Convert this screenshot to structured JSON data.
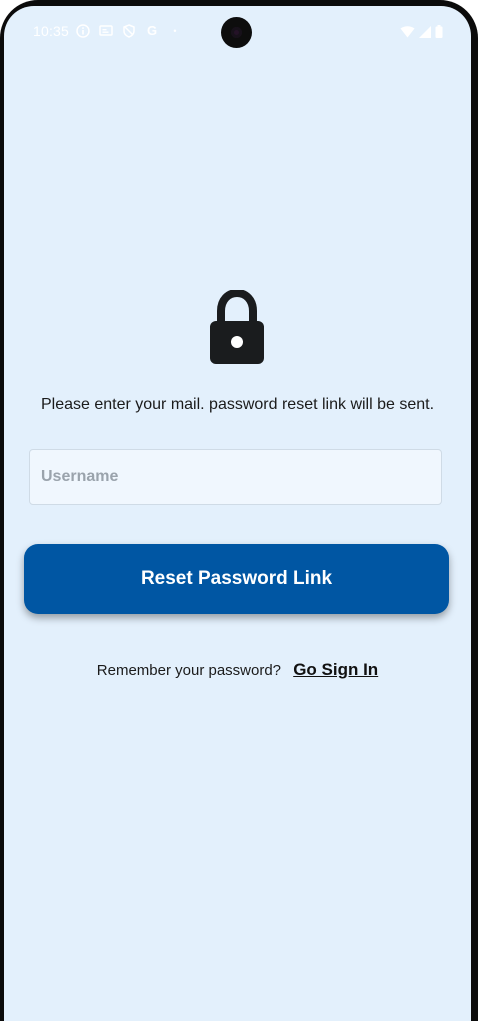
{
  "status_bar": {
    "time": "10:35",
    "left_icons": [
      "info-icon",
      "cast-icon",
      "shield-icon",
      "google-icon",
      "dot-icon"
    ],
    "right_icons": [
      "wifi-icon",
      "signal-icon",
      "battery-icon"
    ],
    "google_glyph": "G",
    "dot_glyph": "•"
  },
  "reset": {
    "instruction": "Please enter your mail. password reset link will be sent.",
    "username_placeholder": "Username",
    "username_value": "",
    "button_label": "Reset Password Link",
    "remember_prompt": "Remember your password?",
    "sign_in_link": "Go Sign In"
  },
  "colors": {
    "background": "#e3f0fc",
    "primary": "#0056a3",
    "field_background": "#f0f7fe"
  }
}
